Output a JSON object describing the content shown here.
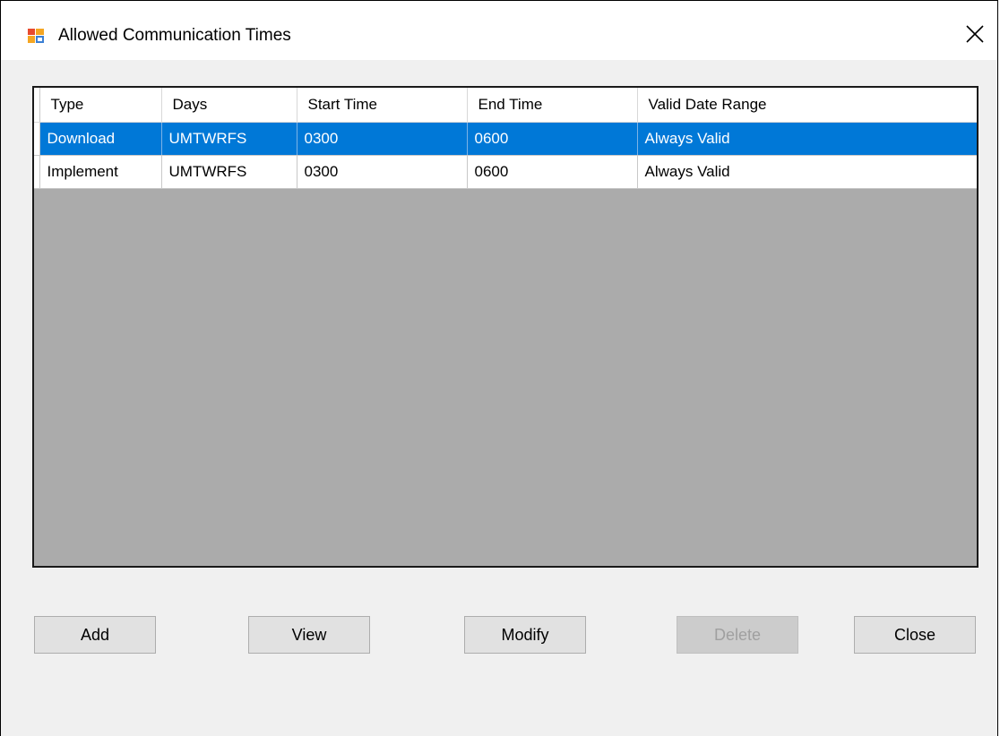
{
  "window": {
    "title": "Allowed Communication Times"
  },
  "grid": {
    "columns": [
      "Type",
      "Days",
      "Start Time",
      "End Time",
      "Valid Date Range"
    ],
    "rows": [
      {
        "type": "Download",
        "days": "UMTWRFS",
        "start": "0300",
        "end": "0600",
        "range": "Always Valid",
        "selected": true
      },
      {
        "type": "Implement",
        "days": "UMTWRFS",
        "start": "0300",
        "end": "0600",
        "range": "Always Valid",
        "selected": false
      }
    ]
  },
  "buttons": {
    "add": "Add",
    "view": "View",
    "modify": "Modify",
    "delete": "Delete",
    "close": "Close"
  },
  "colors": {
    "selection": "#0078d7",
    "empty_grid": "#ababab",
    "dialog_bg": "#f0f0f0"
  },
  "icons": {
    "app": "windows-form-icon",
    "close": "close-icon"
  }
}
